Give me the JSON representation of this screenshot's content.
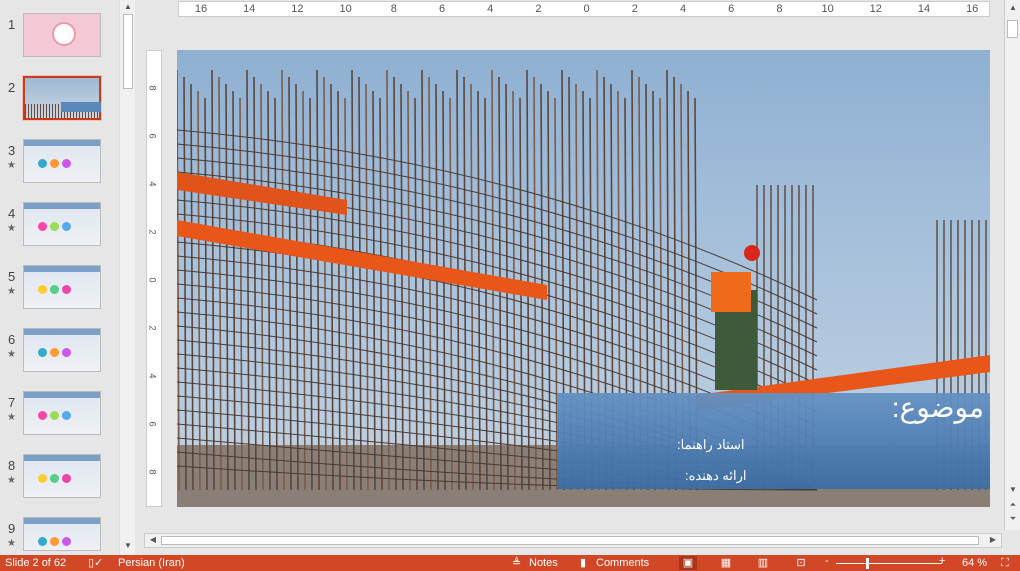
{
  "thumbnails": [
    {
      "num": "1",
      "star": false,
      "selected": false
    },
    {
      "num": "2",
      "star": false,
      "selected": true
    },
    {
      "num": "3",
      "star": true,
      "selected": false
    },
    {
      "num": "4",
      "star": true,
      "selected": false
    },
    {
      "num": "5",
      "star": true,
      "selected": false
    },
    {
      "num": "6",
      "star": true,
      "selected": false
    },
    {
      "num": "7",
      "star": true,
      "selected": false
    },
    {
      "num": "8",
      "star": true,
      "selected": false
    },
    {
      "num": "9",
      "star": true,
      "selected": false
    }
  ],
  "ruler_h": [
    "16",
    "14",
    "12",
    "10",
    "8",
    "6",
    "4",
    "2",
    "0",
    "2",
    "4",
    "6",
    "8",
    "10",
    "12",
    "14",
    "16"
  ],
  "ruler_v": [
    "8",
    "6",
    "4",
    "2",
    "0",
    "2",
    "4",
    "6",
    "8"
  ],
  "slide": {
    "title": "موضوع:",
    "line1": "استاد راهنما:",
    "line2": "ارائه دهنده:"
  },
  "status": {
    "slide": "Slide 2 of 62",
    "language": "Persian (Iran)",
    "notes": "Notes",
    "comments": "Comments",
    "zoom": "64 %",
    "zoom_level_percent": 64
  },
  "colors": {
    "status_bar": "#d24726",
    "selected_thumb": "#c43e1c",
    "caption": "#4f7fb5"
  }
}
